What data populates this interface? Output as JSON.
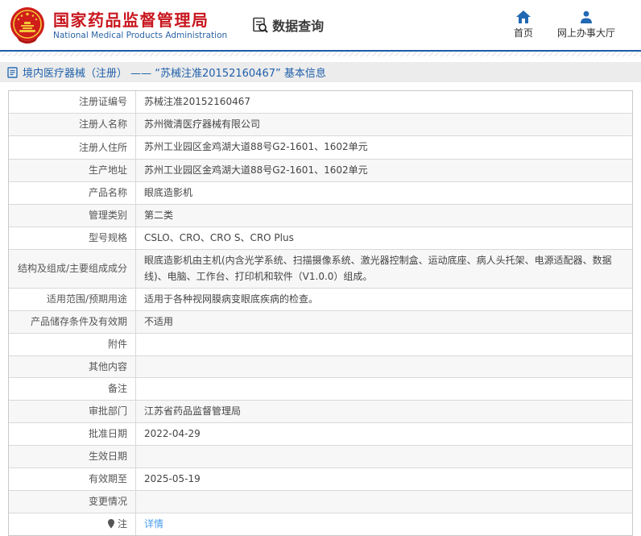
{
  "header": {
    "agency_cn": "国家药品监督管理局",
    "agency_en": "National Medical Products Administration",
    "data_query_label": "数据查询",
    "nav": {
      "home": "首页",
      "service_hall": "网上办事大厅"
    }
  },
  "breadcrumb": {
    "text": "境内医疗器械（注册） ——  “苏械注准20152160467”  基本信息"
  },
  "colors": {
    "brand_red": "#c8161e",
    "brand_blue": "#1b5caa",
    "nav_icon_blue": "#2268b2",
    "link_blue": "#4a9cf0",
    "row_alt_bg": "#f7f7f7"
  },
  "table": {
    "rows": [
      {
        "label": "注册证编号",
        "value": "苏械注准20152160467"
      },
      {
        "label": "注册人名称",
        "value": "苏州微清医疗器械有限公司"
      },
      {
        "label": "注册人住所",
        "value": "苏州工业园区金鸡湖大道88号G2-1601、1602单元"
      },
      {
        "label": "生产地址",
        "value": "苏州工业园区金鸡湖大道88号G2-1601、1602单元"
      },
      {
        "label": "产品名称",
        "value": "眼底造影机"
      },
      {
        "label": "管理类别",
        "value": "第二类"
      },
      {
        "label": "型号规格",
        "value": "CSLO、CRO、CRO S、CRO Plus"
      },
      {
        "label": "结构及组成/主要组成成分",
        "value": "眼底造影机由主机(内含光学系统、扫描摄像系统、激光器控制盒、运动底座、病人头托架、电源适配器、数据线)、电脑、工作台、打印机和软件（V1.0.0）组成。"
      },
      {
        "label": "适用范围/预期用途",
        "value": "适用于各种视网膜病变眼底疾病的检查。"
      },
      {
        "label": "产品储存条件及有效期",
        "value": "不适用"
      },
      {
        "label": "附件",
        "value": ""
      },
      {
        "label": "其他内容",
        "value": ""
      },
      {
        "label": "备注",
        "value": ""
      },
      {
        "label": "审批部门",
        "value": "江苏省药品监督管理局"
      },
      {
        "label": "批准日期",
        "value": "2022-04-29"
      },
      {
        "label": "生效日期",
        "value": ""
      },
      {
        "label": "有效期至",
        "value": "2025-05-19"
      },
      {
        "label": "变更情况",
        "value": ""
      },
      {
        "label": "注",
        "value": "详情",
        "label_icon": "pin-icon",
        "value_is_link": true
      }
    ]
  }
}
